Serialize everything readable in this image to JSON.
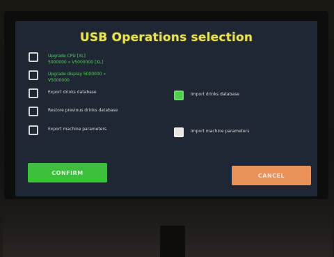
{
  "title": "USB Operations selection",
  "options": [
    {
      "label": "Upgrade CPU [XL]\n5000000 » V5000000 [XL]",
      "checked": false
    },
    {
      "label": "Upgrade display 5000000 »\nV5000000",
      "checked": false
    },
    {
      "label": "Export drinks database",
      "checked": false
    },
    {
      "label": "Import drinks database",
      "checked": true
    },
    {
      "label": "Restore previous drinks database",
      "checked": false
    },
    {
      "label": "Export machine parameters",
      "checked": false
    },
    {
      "label": "Import machine parameters",
      "checked": false
    }
  ],
  "buttons": {
    "confirm": "CONFIRM",
    "cancel": "CANCEL"
  },
  "colors": {
    "screen": "#1f2735",
    "title": "#e9e35a",
    "confirm": "#3cc03c",
    "cancel": "#e8915a",
    "checked": "#4cd14a"
  }
}
